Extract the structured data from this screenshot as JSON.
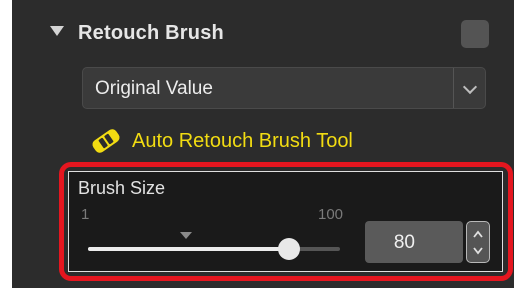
{
  "section": {
    "title": "Retouch Brush",
    "select_value": "Original Value",
    "tool_label": "Auto Retouch Brush Tool"
  },
  "brush_size": {
    "label": "Brush Size",
    "min_label": "1",
    "max_label": "100",
    "value_text": "80",
    "value": 80,
    "min": 1,
    "max": 100
  },
  "colors": {
    "panel_bg": "#2c2c2c",
    "tool_label": "#f2dc12",
    "highlight_outline": "#e5161f"
  },
  "icons": {
    "collapse": "triangle-down-icon",
    "dropdown": "chevron-down-icon",
    "tool": "eraser-icon",
    "spinner": "up-down-arrows-icon"
  }
}
